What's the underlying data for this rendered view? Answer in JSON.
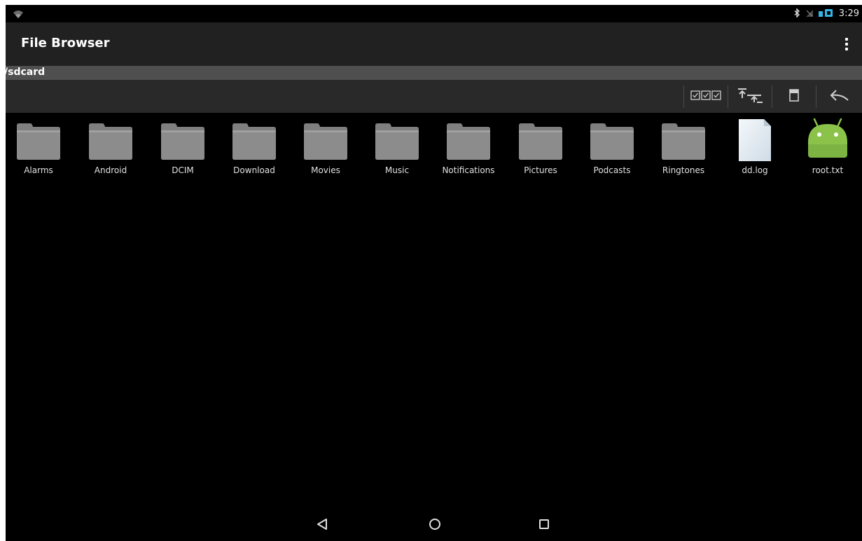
{
  "status_bar": {
    "time": "3:29",
    "icons": [
      "wifi-icon",
      "bluetooth-icon",
      "no-signal-icon",
      "battery-icon"
    ]
  },
  "app_bar": {
    "title": "File Browser",
    "overflow_icon": "more-vert-icon"
  },
  "path": "/sdcard",
  "toolbar": {
    "buttons": [
      "multi-select-icon",
      "transfer-icon",
      "storage-icon",
      "back-arrow-icon"
    ]
  },
  "files": [
    {
      "name": "Alarms",
      "type": "folder"
    },
    {
      "name": "Android",
      "type": "folder"
    },
    {
      "name": "DCIM",
      "type": "folder"
    },
    {
      "name": "Download",
      "type": "folder"
    },
    {
      "name": "Movies",
      "type": "folder"
    },
    {
      "name": "Music",
      "type": "folder"
    },
    {
      "name": "Notifications",
      "type": "folder"
    },
    {
      "name": "Pictures",
      "type": "folder"
    },
    {
      "name": "Podcasts",
      "type": "folder"
    },
    {
      "name": "Ringtones",
      "type": "folder"
    },
    {
      "name": "dd.log",
      "type": "document"
    },
    {
      "name": "root.txt",
      "type": "android"
    }
  ],
  "nav_bar": {
    "buttons": [
      "back-icon",
      "home-icon",
      "recents-icon"
    ]
  },
  "colors": {
    "background": "#000000",
    "app_bar": "#212121",
    "path_bar": "#4f4f4f",
    "toolbar": "#292929",
    "android_green": "#8bc34a",
    "folder_gray": "#8a8a8a",
    "text": "#e0e0e0"
  }
}
